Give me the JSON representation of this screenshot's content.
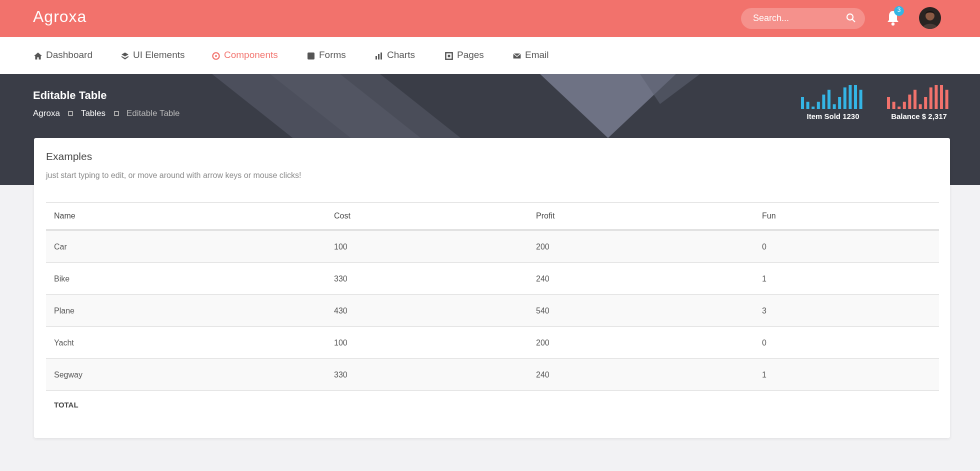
{
  "app": {
    "logo": "Agroxa"
  },
  "search": {
    "placeholder": "Search..."
  },
  "notifications": {
    "count": "3"
  },
  "nav": [
    {
      "label": "Dashboard",
      "icon": "home-icon"
    },
    {
      "label": "UI Elements",
      "icon": "layers-icon"
    },
    {
      "label": "Components",
      "icon": "palette-icon"
    },
    {
      "label": "Forms",
      "icon": "form-icon"
    },
    {
      "label": "Charts",
      "icon": "chart-icon"
    },
    {
      "label": "Pages",
      "icon": "pages-icon"
    },
    {
      "label": "Email",
      "icon": "email-icon"
    }
  ],
  "header": {
    "title": "Editable Table",
    "breadcrumbs": [
      "Agroxa",
      "Tables",
      "Editable Table"
    ],
    "stats": [
      {
        "label": "Item Sold 1230",
        "color": "#34b5e5",
        "bars": [
          5,
          3,
          1,
          3,
          6,
          8,
          2,
          5,
          9,
          10,
          10,
          8
        ]
      },
      {
        "label": "Balance $ 2,317",
        "color": "#f2726c",
        "bars": [
          5,
          3,
          1,
          3,
          6,
          8,
          2,
          5,
          9,
          10,
          10,
          8
        ]
      }
    ]
  },
  "card": {
    "title": "Examples",
    "subtitle": "just start typing to edit, or move around with arrow keys or mouse clicks!",
    "columns": [
      "Name",
      "Cost",
      "Profit",
      "Fun"
    ],
    "rows": [
      [
        "Car",
        "100",
        "200",
        "0"
      ],
      [
        "Bike",
        "330",
        "240",
        "1"
      ],
      [
        "Plane",
        "430",
        "540",
        "3"
      ],
      [
        "Yacht",
        "100",
        "200",
        "0"
      ],
      [
        "Segway",
        "330",
        "240",
        "1"
      ]
    ],
    "total_label": "TOTAL"
  },
  "colors": {
    "accent": "#f2726c",
    "header_bg": "#3a3d47",
    "info": "#34b5e5"
  }
}
